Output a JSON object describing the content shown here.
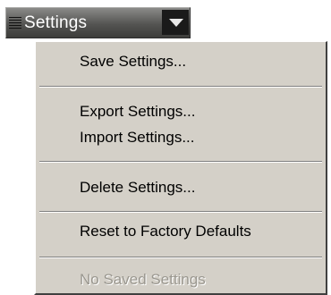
{
  "dropdown": {
    "label": "Settings",
    "grip_icon": "drag-grip-icon",
    "arrow_icon": "triangle-down-icon"
  },
  "menu": {
    "items": [
      {
        "label": "Save Settings...",
        "enabled": true
      },
      {
        "label": "Export Settings...",
        "enabled": true
      },
      {
        "label": "Import Settings...",
        "enabled": true
      },
      {
        "label": "Delete Settings...",
        "enabled": true
      },
      {
        "label": "Reset to Factory Defaults",
        "enabled": true
      },
      {
        "label": "No Saved Settings",
        "enabled": false
      }
    ]
  },
  "colors": {
    "menu_background": "#d4d0c8",
    "disabled_text": "#9a978f",
    "dropdown_background": "#545452"
  }
}
